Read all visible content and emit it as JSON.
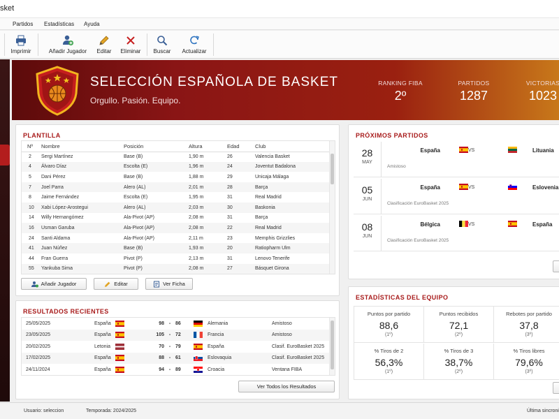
{
  "window": {
    "title": "sket"
  },
  "menu": [
    "Partidos",
    "Estadísticas",
    "Ayuda"
  ],
  "toolbar": {
    "print": "Imprimir",
    "add_player": "Añadir Jugador",
    "edit": "Editar",
    "delete": "Eliminar",
    "search": "Buscar",
    "refresh": "Actualizar"
  },
  "banner": {
    "title": "SELECCIÓN ESPAÑOLA DE BASKET",
    "subtitle": "Orgullo. Pasión. Equipo.",
    "stats": [
      {
        "label": "RANKING FIBA",
        "value": "2º"
      },
      {
        "label": "PARTIDOS",
        "value": "1287"
      },
      {
        "label": "VICTORIAS",
        "value": "1023"
      }
    ]
  },
  "roster": {
    "title": "PLANTILLA",
    "columns": [
      "Nº",
      "Nombre",
      "Posición",
      "Altura",
      "Edad",
      "Club"
    ],
    "rows": [
      [
        "2",
        "Sergi Martínez",
        "Base (B)",
        "1,90 m",
        "26",
        "Valencia Basket"
      ],
      [
        "4",
        "Álvaro Díaz",
        "Escolta (E)",
        "1,96 m",
        "24",
        "Joventut Badalona"
      ],
      [
        "5",
        "Dani Pérez",
        "Base (B)",
        "1,88 m",
        "29",
        "Unicaja Málaga"
      ],
      [
        "7",
        "Joel Parra",
        "Alero (AL)",
        "2,01 m",
        "28",
        "Barça"
      ],
      [
        "8",
        "Jaime Fernández",
        "Escolta (E)",
        "1,95 m",
        "31",
        "Real Madrid"
      ],
      [
        "10",
        "Xabi López-Arostegui",
        "Alero (AL)",
        "2,03 m",
        "30",
        "Baskonia"
      ],
      [
        "14",
        "Willy Hernangómez",
        "Ala-Pivot (AP)",
        "2,08 m",
        "31",
        "Barça"
      ],
      [
        "16",
        "Usman Garuba",
        "Ala-Pivot (AP)",
        "2,08 m",
        "22",
        "Real Madrid"
      ],
      [
        "24",
        "Santi Aldama",
        "Ala-Pivot (AP)",
        "2,11 m",
        "23",
        "Memphis Grizzlies"
      ],
      [
        "41",
        "Juan Núñez",
        "Base (B)",
        "1,93 m",
        "20",
        "Ratiopharm Ulm"
      ],
      [
        "44",
        "Fran Guerra",
        "Pivot (P)",
        "2,13 m",
        "31",
        "Lenovo Tenerife"
      ],
      [
        "55",
        "Yankuba Sima",
        "Pivot (P)",
        "2,08 m",
        "27",
        "Básquet Girona"
      ]
    ],
    "buttons": {
      "add": "Añadir Jugador",
      "edit": "Editar",
      "view": "Ver Ficha"
    }
  },
  "results": {
    "title": "RESULTADOS RECIENTES",
    "rows": [
      {
        "date": "25/05/2025",
        "home": "España",
        "home_flag": "es",
        "score_home": "98",
        "score_away": "86",
        "away": "Alemania",
        "away_flag": "de",
        "comp": "Amistoso"
      },
      {
        "date": "23/05/2025",
        "home": "España",
        "home_flag": "es",
        "score_home": "105",
        "score_away": "72",
        "away": "Francia",
        "away_flag": "fr",
        "comp": "Amistoso"
      },
      {
        "date": "20/02/2025",
        "home": "Letonia",
        "home_flag": "lv",
        "score_home": "70",
        "score_away": "79",
        "away": "España",
        "away_flag": "es",
        "comp": "Clasif. EuroBasket 2025"
      },
      {
        "date": "17/02/2025",
        "home": "España",
        "home_flag": "es",
        "score_home": "88",
        "score_away": "61",
        "away": "Eslovaquia",
        "away_flag": "sk",
        "comp": "Clasif. EuroBasket 2025"
      },
      {
        "date": "24/11/2024",
        "home": "España",
        "home_flag": "es",
        "score_home": "94",
        "score_away": "89",
        "away": "Croacia",
        "away_flag": "hr",
        "comp": "Ventana FIBA"
      }
    ],
    "button": "Ver Todos los Resultados"
  },
  "upcoming": {
    "title": "PRÓXIMOS PARTIDOS",
    "matches": [
      {
        "day": "28",
        "month": "MAY",
        "home": "España",
        "home_flag": "es",
        "vs": "VS",
        "away": "Lituania",
        "away_flag": "lt",
        "comp": "Amistoso"
      },
      {
        "day": "05",
        "month": "JUN",
        "home": "España",
        "home_flag": "es",
        "vs": "VS",
        "away": "Eslovenia",
        "away_flag": "si",
        "comp": "Clasificación EuroBasket 2025"
      },
      {
        "day": "08",
        "month": "JUN",
        "home": "Bélgica",
        "home_flag": "be",
        "vs": "VS",
        "away": "España",
        "away_flag": "es",
        "comp": "Clasificación EuroBasket 2025"
      }
    ]
  },
  "team_stats": {
    "title": "ESTADÍSTICAS DEL EQUIPO",
    "cells": [
      {
        "label": "Puntos por partido",
        "value": "88,6",
        "rank": "(1º)"
      },
      {
        "label": "Puntos recibidos",
        "value": "72,1",
        "rank": "(2º)"
      },
      {
        "label": "Rebotes por partido",
        "value": "37,8",
        "rank": "(3º)"
      },
      {
        "label": "% Tiros de 2",
        "value": "56,3%",
        "rank": "(1º)"
      },
      {
        "label": "% Tiros de 3",
        "value": "38,7%",
        "rank": "(2º)"
      },
      {
        "label": "% Tiros libres",
        "value": "79,6%",
        "rank": "(3º)"
      }
    ]
  },
  "status": {
    "user_label": "Usuario:",
    "user": "seleccion",
    "season_label": "Temporada:",
    "season": "2024/2025",
    "sync": "Última sincroni"
  },
  "colors": {
    "accent": "#a81b1b",
    "banner_dark": "#5c0b0b",
    "banner_light": "#c8781a"
  }
}
